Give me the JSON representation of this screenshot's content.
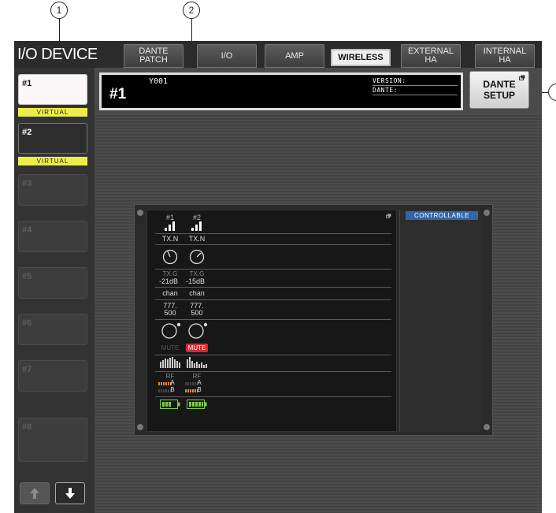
{
  "callouts": [
    "1",
    "2"
  ],
  "app": {
    "title": "I/O DEVICE",
    "tabs": [
      {
        "label": "DANTE\nPATCH",
        "active": false
      },
      {
        "label": "I/O",
        "active": false
      },
      {
        "label": "AMP",
        "active": false
      },
      {
        "label": "WIRELESS",
        "active": true
      },
      {
        "label": "EXTERNAL\nHA",
        "active": false
      },
      {
        "label": "INTERNAL\nHA",
        "active": false
      }
    ]
  },
  "slots": [
    {
      "label": "#1",
      "virtual": "VIRTUAL",
      "state": "selected"
    },
    {
      "label": "#2",
      "virtual": "VIRTUAL",
      "state": "on"
    },
    {
      "label": "#3",
      "state": "off"
    },
    {
      "label": "#4",
      "state": "off"
    },
    {
      "label": "#5",
      "state": "off"
    },
    {
      "label": "#6",
      "state": "off"
    },
    {
      "label": "#7",
      "state": "off"
    },
    {
      "label": "#8",
      "state": "off"
    }
  ],
  "info": {
    "slot": "#1",
    "device_id": "Y001",
    "version_label": "VERSION:",
    "dante_label": "DANTE:"
  },
  "dante_setup_button": "DANTE\nSETUP",
  "panel": {
    "status": "CONTROLLABLE",
    "channels": [
      {
        "num": "#1",
        "type": "TX.N",
        "gain_label": "TX.G",
        "gain": "-21dB",
        "name": "chan",
        "freq1": "777.",
        "freq2": "500",
        "mute": "MUTE",
        "mute_on": false,
        "rf": "RF",
        "rf_a": "A",
        "rf_b": "B"
      },
      {
        "num": "#2",
        "type": "TX.N",
        "gain_label": "TX.G",
        "gain": "-15dB",
        "name": "chan",
        "freq1": "777.",
        "freq2": "500",
        "mute": "MUTE",
        "mute_on": true,
        "rf": "RF",
        "rf_a": "A",
        "rf_b": "B"
      }
    ]
  },
  "colors": {
    "virtual_badge": "#eded4a",
    "mute_active": "#d9272e",
    "controllable": "#3366a8",
    "rf_bar": "#e8872e",
    "battery": "#7fd03a"
  }
}
